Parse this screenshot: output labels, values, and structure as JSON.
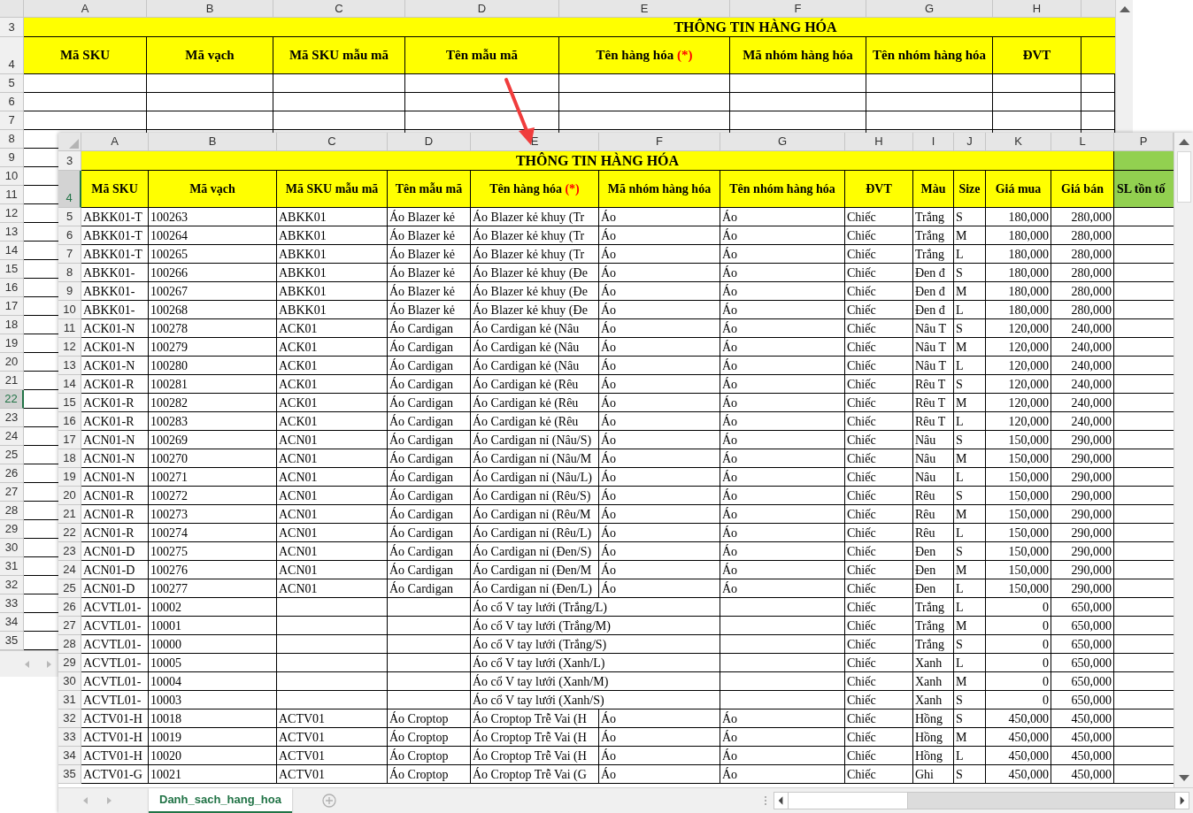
{
  "background_sheet": {
    "columns": [
      "A",
      "B",
      "C",
      "D",
      "E",
      "F",
      "G",
      "H"
    ],
    "row_numbers": [
      {
        "label": "3",
        "selected": false
      },
      {
        "label": "4",
        "selected": false
      },
      {
        "label": "5",
        "selected": false
      },
      {
        "label": "6",
        "selected": false
      },
      {
        "label": "7",
        "selected": false
      },
      {
        "label": "8",
        "selected": false
      },
      {
        "label": "9",
        "selected": false
      },
      {
        "label": "10",
        "selected": false
      },
      {
        "label": "11",
        "selected": false
      },
      {
        "label": "12",
        "selected": false
      },
      {
        "label": "13",
        "selected": false
      },
      {
        "label": "14",
        "selected": false
      },
      {
        "label": "15",
        "selected": false
      },
      {
        "label": "16",
        "selected": false
      },
      {
        "label": "17",
        "selected": false
      },
      {
        "label": "18",
        "selected": false
      },
      {
        "label": "19",
        "selected": false
      },
      {
        "label": "20",
        "selected": false
      },
      {
        "label": "21",
        "selected": false
      },
      {
        "label": "22",
        "selected": true
      },
      {
        "label": "23",
        "selected": false
      },
      {
        "label": "24",
        "selected": false
      },
      {
        "label": "25",
        "selected": false
      },
      {
        "label": "26",
        "selected": false
      },
      {
        "label": "27",
        "selected": false
      },
      {
        "label": "28",
        "selected": false
      },
      {
        "label": "29",
        "selected": false
      },
      {
        "label": "30",
        "selected": false
      },
      {
        "label": "31",
        "selected": false
      },
      {
        "label": "32",
        "selected": false
      },
      {
        "label": "33",
        "selected": false
      },
      {
        "label": "34",
        "selected": false
      },
      {
        "label": "35",
        "selected": false
      }
    ],
    "title": "THÔNG TIN HÀNG HÓA",
    "headers": [
      {
        "text": "Mã SKU"
      },
      {
        "text": "Mã vạch"
      },
      {
        "text": "Mã SKU mẫu mã"
      },
      {
        "text": "Tên mẫu mã"
      },
      {
        "text": "Tên hàng hóa",
        "mark": "(*)"
      },
      {
        "text": "Mã nhóm hàng hóa"
      },
      {
        "text": "Tên nhóm hàng hóa"
      },
      {
        "text": "ĐVT"
      }
    ]
  },
  "front_sheet": {
    "columns": [
      "A",
      "B",
      "C",
      "D",
      "E",
      "F",
      "G",
      "H",
      "I",
      "J",
      "K",
      "L",
      "P"
    ],
    "title_row": {
      "label": "3",
      "selected": false
    },
    "header_row": {
      "label": "4",
      "selected": true
    },
    "title": "THÔNG TIN HÀNG HÓA",
    "headers": [
      {
        "text": "Mã SKU"
      },
      {
        "text": "Mã vạch"
      },
      {
        "text": "Mã SKU mẫu mã"
      },
      {
        "text": "Tên mẫu mã"
      },
      {
        "text": "Tên hàng hóa",
        "mark": "(*)"
      },
      {
        "text": "Mã nhóm hàng hóa"
      },
      {
        "text": "Tên nhóm hàng hóa"
      },
      {
        "text": "ĐVT"
      },
      {
        "text": "Màu"
      },
      {
        "text": "Size"
      },
      {
        "text": "Giá mua"
      },
      {
        "text": "Giá bán"
      }
    ],
    "stock_header": "SL tồn tố",
    "rows": [
      {
        "row": "5",
        "sku": "ABKK01-T",
        "barcode": "100263",
        "model_sku": "ABKK01",
        "model_name": "Áo Blazer kẻ",
        "name": "Áo Blazer kẻ khuy (Tr",
        "group_code": "Áo",
        "group_name": "Áo",
        "unit": "Chiếc",
        "variant_color": "Trắng",
        "size": "S",
        "buy_price": "180,000",
        "sell_price": "280,000"
      },
      {
        "row": "6",
        "sku": "ABKK01-T",
        "barcode": "100264",
        "model_sku": "ABKK01",
        "model_name": "Áo Blazer kẻ",
        "name": "Áo Blazer kẻ khuy (Tr",
        "group_code": "Áo",
        "group_name": "Áo",
        "unit": "Chiếc",
        "variant_color": "Trắng",
        "size": "M",
        "buy_price": "180,000",
        "sell_price": "280,000"
      },
      {
        "row": "7",
        "sku": "ABKK01-T",
        "barcode": "100265",
        "model_sku": "ABKK01",
        "model_name": "Áo Blazer kẻ",
        "name": "Áo Blazer kẻ khuy (Tr",
        "group_code": "Áo",
        "group_name": "Áo",
        "unit": "Chiếc",
        "variant_color": "Trắng",
        "size": "L",
        "buy_price": "180,000",
        "sell_price": "280,000"
      },
      {
        "row": "8",
        "sku": "ABKK01-",
        "barcode": "100266",
        "model_sku": "ABKK01",
        "model_name": "Áo Blazer kẻ",
        "name": "Áo Blazer kẻ khuy (Đe",
        "group_code": "Áo",
        "group_name": "Áo",
        "unit": "Chiếc",
        "variant_color": "Đen đ",
        "size": "S",
        "buy_price": "180,000",
        "sell_price": "280,000"
      },
      {
        "row": "9",
        "sku": "ABKK01-",
        "barcode": "100267",
        "model_sku": "ABKK01",
        "model_name": "Áo Blazer kẻ",
        "name": "Áo Blazer kẻ khuy (Đe",
        "group_code": "Áo",
        "group_name": "Áo",
        "unit": "Chiếc",
        "variant_color": "Đen đ",
        "size": "M",
        "buy_price": "180,000",
        "sell_price": "280,000"
      },
      {
        "row": "10",
        "sku": "ABKK01-",
        "barcode": "100268",
        "model_sku": "ABKK01",
        "model_name": "Áo Blazer kẻ",
        "name": "Áo Blazer kẻ khuy (Đe",
        "group_code": "Áo",
        "group_name": "Áo",
        "unit": "Chiếc",
        "variant_color": "Đen đ",
        "size": "L",
        "buy_price": "180,000",
        "sell_price": "280,000"
      },
      {
        "row": "11",
        "sku": "ACK01-N",
        "barcode": "100278",
        "model_sku": "ACK01",
        "model_name": "Áo Cardigan",
        "name": "Áo Cardigan kẻ (Nâu",
        "group_code": "Áo",
        "group_name": "Áo",
        "unit": "Chiếc",
        "variant_color": "Nâu T",
        "size": "S",
        "buy_price": "120,000",
        "sell_price": "240,000"
      },
      {
        "row": "12",
        "sku": "ACK01-N",
        "barcode": "100279",
        "model_sku": "ACK01",
        "model_name": "Áo Cardigan",
        "name": "Áo Cardigan kẻ (Nâu",
        "group_code": "Áo",
        "group_name": "Áo",
        "unit": "Chiếc",
        "variant_color": "Nâu T",
        "size": "M",
        "buy_price": "120,000",
        "sell_price": "240,000"
      },
      {
        "row": "13",
        "sku": "ACK01-N",
        "barcode": "100280",
        "model_sku": "ACK01",
        "model_name": "Áo Cardigan",
        "name": "Áo Cardigan kẻ (Nâu",
        "group_code": "Áo",
        "group_name": "Áo",
        "unit": "Chiếc",
        "variant_color": "Nâu T",
        "size": "L",
        "buy_price": "120,000",
        "sell_price": "240,000"
      },
      {
        "row": "14",
        "sku": "ACK01-R",
        "barcode": "100281",
        "model_sku": "ACK01",
        "model_name": "Áo Cardigan",
        "name": "Áo Cardigan kẻ (Rêu",
        "group_code": "Áo",
        "group_name": "Áo",
        "unit": "Chiếc",
        "variant_color": "Rêu T",
        "size": "S",
        "buy_price": "120,000",
        "sell_price": "240,000"
      },
      {
        "row": "15",
        "sku": "ACK01-R",
        "barcode": "100282",
        "model_sku": "ACK01",
        "model_name": "Áo Cardigan",
        "name": "Áo Cardigan kẻ (Rêu",
        "group_code": "Áo",
        "group_name": "Áo",
        "unit": "Chiếc",
        "variant_color": "Rêu T",
        "size": "M",
        "buy_price": "120,000",
        "sell_price": "240,000"
      },
      {
        "row": "16",
        "sku": "ACK01-R",
        "barcode": "100283",
        "model_sku": "ACK01",
        "model_name": "Áo Cardigan",
        "name": "Áo Cardigan kẻ (Rêu",
        "group_code": "Áo",
        "group_name": "Áo",
        "unit": "Chiếc",
        "variant_color": "Rêu T",
        "size": "L",
        "buy_price": "120,000",
        "sell_price": "240,000"
      },
      {
        "row": "17",
        "sku": "ACN01-N",
        "barcode": "100269",
        "model_sku": "ACN01",
        "model_name": "Áo Cardigan",
        "name": "Áo Cardigan nỉ (Nâu/S)",
        "group_code": "Áo",
        "group_name": "Áo",
        "unit": "Chiếc",
        "variant_color": "Nâu",
        "size": "S",
        "buy_price": "150,000",
        "sell_price": "290,000"
      },
      {
        "row": "18",
        "sku": "ACN01-N",
        "barcode": "100270",
        "model_sku": "ACN01",
        "model_name": "Áo Cardigan",
        "name": "Áo Cardigan nỉ (Nâu/M",
        "group_code": "Áo",
        "group_name": "Áo",
        "unit": "Chiếc",
        "variant_color": "Nâu",
        "size": "M",
        "buy_price": "150,000",
        "sell_price": "290,000"
      },
      {
        "row": "19",
        "sku": "ACN01-N",
        "barcode": "100271",
        "model_sku": "ACN01",
        "model_name": "Áo Cardigan",
        "name": "Áo Cardigan nỉ (Nâu/L)",
        "group_code": "Áo",
        "group_name": "Áo",
        "unit": "Chiếc",
        "variant_color": "Nâu",
        "size": "L",
        "buy_price": "150,000",
        "sell_price": "290,000"
      },
      {
        "row": "20",
        "sku": "ACN01-R",
        "barcode": "100272",
        "model_sku": "ACN01",
        "model_name": "Áo Cardigan",
        "name": "Áo Cardigan nỉ (Rêu/S)",
        "group_code": "Áo",
        "group_name": "Áo",
        "unit": "Chiếc",
        "variant_color": "Rêu",
        "size": "S",
        "buy_price": "150,000",
        "sell_price": "290,000"
      },
      {
        "row": "21",
        "sku": "ACN01-R",
        "barcode": "100273",
        "model_sku": "ACN01",
        "model_name": "Áo Cardigan",
        "name": "Áo Cardigan nỉ (Rêu/M",
        "group_code": "Áo",
        "group_name": "Áo",
        "unit": "Chiếc",
        "variant_color": "Rêu",
        "size": "M",
        "buy_price": "150,000",
        "sell_price": "290,000"
      },
      {
        "row": "22",
        "sku": "ACN01-R",
        "barcode": "100274",
        "model_sku": "ACN01",
        "model_name": "Áo Cardigan",
        "name": "Áo Cardigan nỉ (Rêu/L)",
        "group_code": "Áo",
        "group_name": "Áo",
        "unit": "Chiếc",
        "variant_color": "Rêu",
        "size": "L",
        "buy_price": "150,000",
        "sell_price": "290,000"
      },
      {
        "row": "23",
        "sku": "ACN01-D",
        "barcode": "100275",
        "model_sku": "ACN01",
        "model_name": "Áo Cardigan",
        "name": "Áo Cardigan nỉ (Đen/S)",
        "group_code": "Áo",
        "group_name": "Áo",
        "unit": "Chiếc",
        "variant_color": "Đen",
        "size": "S",
        "buy_price": "150,000",
        "sell_price": "290,000"
      },
      {
        "row": "24",
        "sku": "ACN01-D",
        "barcode": "100276",
        "model_sku": "ACN01",
        "model_name": "Áo Cardigan",
        "name": "Áo Cardigan nỉ (Đen/M",
        "group_code": "Áo",
        "group_name": "Áo",
        "unit": "Chiếc",
        "variant_color": "Đen",
        "size": "M",
        "buy_price": "150,000",
        "sell_price": "290,000"
      },
      {
        "row": "25",
        "sku": "ACN01-D",
        "barcode": "100277",
        "model_sku": "ACN01",
        "model_name": "Áo Cardigan",
        "name": "Áo Cardigan nỉ (Đen/L)",
        "group_code": "Áo",
        "group_name": "Áo",
        "unit": "Chiếc",
        "variant_color": "Đen",
        "size": "L",
        "buy_price": "150,000",
        "sell_price": "290,000"
      },
      {
        "row": "26",
        "sku": "ACVTL01-",
        "barcode": "10002",
        "name": "Áo cổ V tay lưới (Trắng/L)",
        "unit": "Chiếc",
        "variant_color": "Trắng",
        "size": "L",
        "buy_price": "0",
        "sell_price": "650,000"
      },
      {
        "row": "27",
        "sku": "ACVTL01-",
        "barcode": "10001",
        "name": "Áo cổ V tay lưới (Trắng/M)",
        "unit": "Chiếc",
        "variant_color": "Trắng",
        "size": "M",
        "buy_price": "0",
        "sell_price": "650,000"
      },
      {
        "row": "28",
        "sku": "ACVTL01-",
        "barcode": "10000",
        "name": "Áo cổ V tay lưới (Trắng/S)",
        "unit": "Chiếc",
        "variant_color": "Trắng",
        "size": "S",
        "buy_price": "0",
        "sell_price": "650,000"
      },
      {
        "row": "29",
        "sku": "ACVTL01-",
        "barcode": "10005",
        "name": "Áo cổ V tay lưới (Xanh/L)",
        "unit": "Chiếc",
        "variant_color": "Xanh",
        "size": "L",
        "buy_price": "0",
        "sell_price": "650,000"
      },
      {
        "row": "30",
        "sku": "ACVTL01-",
        "barcode": "10004",
        "name": "Áo cổ V tay lưới (Xanh/M)",
        "unit": "Chiếc",
        "variant_color": "Xanh",
        "size": "M",
        "buy_price": "0",
        "sell_price": "650,000"
      },
      {
        "row": "31",
        "sku": "ACVTL01-",
        "barcode": "10003",
        "name": "Áo cổ V tay lưới (Xanh/S)",
        "unit": "Chiếc",
        "variant_color": "Xanh",
        "size": "S",
        "buy_price": "0",
        "sell_price": "650,000"
      },
      {
        "row": "32",
        "sku": "ACTV01-H",
        "barcode": "10018",
        "model_sku": "ACTV01",
        "model_name": "Áo Croptop",
        "name": "Áo Croptop Trễ Vai (H",
        "group_code": "Áo",
        "group_name": "Áo",
        "unit": "Chiếc",
        "variant_color": "Hồng",
        "size": "S",
        "buy_price": "450,000",
        "sell_price": "450,000"
      },
      {
        "row": "33",
        "sku": "ACTV01-H",
        "barcode": "10019",
        "model_sku": "ACTV01",
        "model_name": "Áo Croptop",
        "name": "Áo Croptop Trễ Vai (H",
        "group_code": "Áo",
        "group_name": "Áo",
        "unit": "Chiếc",
        "variant_color": "Hồng",
        "size": "M",
        "buy_price": "450,000",
        "sell_price": "450,000"
      },
      {
        "row": "34",
        "sku": "ACTV01-H",
        "barcode": "10020",
        "model_sku": "ACTV01",
        "model_name": "Áo Croptop",
        "name": "Áo Croptop Trễ Vai (H",
        "group_code": "Áo",
        "group_name": "Áo",
        "unit": "Chiếc",
        "variant_color": "Hồng",
        "size": "L",
        "buy_price": "450,000",
        "sell_price": "450,000"
      },
      {
        "row": "35",
        "sku": "ACTV01-G",
        "barcode": "10021",
        "model_sku": "ACTV01",
        "model_name": "Áo Croptop",
        "name": "Áo Croptop Trễ Vai (G",
        "group_code": "Áo",
        "group_name": "Áo",
        "unit": "Chiếc",
        "variant_color": "Ghi",
        "size": "S",
        "buy_price": "450,000",
        "sell_price": "450,000"
      }
    ],
    "sheet_tabs": [
      {
        "label": "Danh_sach_hang_hoa",
        "selected": true
      }
    ]
  }
}
